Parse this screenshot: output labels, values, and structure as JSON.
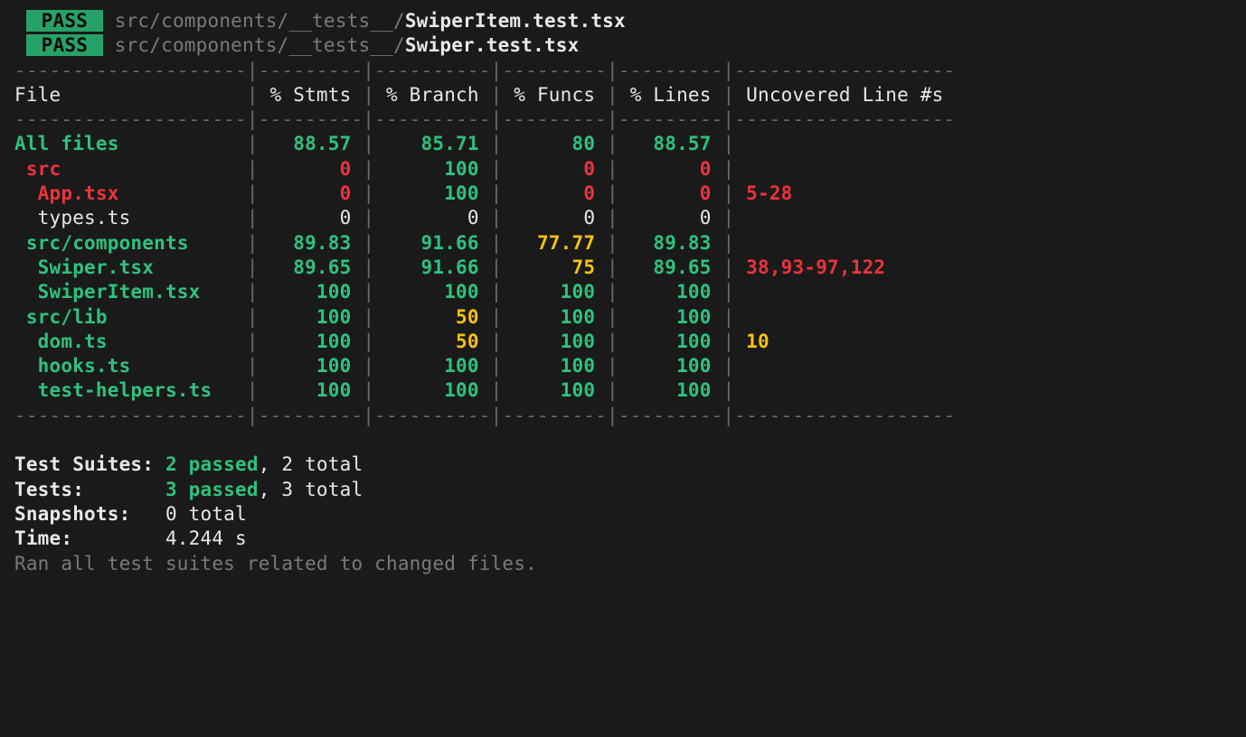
{
  "test_files": [
    {
      "status": "PASS",
      "path_prefix": "src/components/__tests__/",
      "filename": "SwiperItem.test.tsx"
    },
    {
      "status": "PASS",
      "path_prefix": "src/components/__tests__/",
      "filename": "Swiper.test.tsx"
    }
  ],
  "coverage_header": {
    "file": "File",
    "stmts": "% Stmts",
    "branch": "% Branch",
    "funcs": "% Funcs",
    "lines": "% Lines",
    "uncovered": "Uncovered Line #s"
  },
  "coverage_rows": [
    {
      "indent": 0,
      "name": "All files",
      "name_color": "green-bold",
      "stmts": {
        "v": "88.57",
        "c": "green"
      },
      "branch": {
        "v": "85.71",
        "c": "green"
      },
      "funcs": {
        "v": "80",
        "c": "green"
      },
      "lines": {
        "v": "88.57",
        "c": "green"
      },
      "uncovered": {
        "v": "",
        "c": ""
      }
    },
    {
      "indent": 1,
      "name": "src",
      "name_color": "red",
      "stmts": {
        "v": "0",
        "c": "red"
      },
      "branch": {
        "v": "100",
        "c": "green"
      },
      "funcs": {
        "v": "0",
        "c": "red"
      },
      "lines": {
        "v": "0",
        "c": "red"
      },
      "uncovered": {
        "v": "",
        "c": ""
      }
    },
    {
      "indent": 2,
      "name": "App.tsx",
      "name_color": "red",
      "stmts": {
        "v": "0",
        "c": "red"
      },
      "branch": {
        "v": "100",
        "c": "green"
      },
      "funcs": {
        "v": "0",
        "c": "red"
      },
      "lines": {
        "v": "0",
        "c": "red"
      },
      "uncovered": {
        "v": "5-28",
        "c": "red"
      }
    },
    {
      "indent": 2,
      "name": "types.ts",
      "name_color": "white",
      "stmts": {
        "v": "0",
        "c": "white"
      },
      "branch": {
        "v": "0",
        "c": "white"
      },
      "funcs": {
        "v": "0",
        "c": "white"
      },
      "lines": {
        "v": "0",
        "c": "white"
      },
      "uncovered": {
        "v": "",
        "c": ""
      }
    },
    {
      "indent": 1,
      "name": "src/components",
      "name_color": "green-bold",
      "stmts": {
        "v": "89.83",
        "c": "green"
      },
      "branch": {
        "v": "91.66",
        "c": "green"
      },
      "funcs": {
        "v": "77.77",
        "c": "yellow"
      },
      "lines": {
        "v": "89.83",
        "c": "green"
      },
      "uncovered": {
        "v": "",
        "c": ""
      }
    },
    {
      "indent": 2,
      "name": "Swiper.tsx",
      "name_color": "green-bold",
      "stmts": {
        "v": "89.65",
        "c": "green"
      },
      "branch": {
        "v": "91.66",
        "c": "green"
      },
      "funcs": {
        "v": "75",
        "c": "yellow"
      },
      "lines": {
        "v": "89.65",
        "c": "green"
      },
      "uncovered": {
        "v": "38,93-97,122",
        "c": "red"
      }
    },
    {
      "indent": 2,
      "name": "SwiperItem.tsx",
      "name_color": "green-bold",
      "stmts": {
        "v": "100",
        "c": "green"
      },
      "branch": {
        "v": "100",
        "c": "green"
      },
      "funcs": {
        "v": "100",
        "c": "green"
      },
      "lines": {
        "v": "100",
        "c": "green"
      },
      "uncovered": {
        "v": "",
        "c": ""
      }
    },
    {
      "indent": 1,
      "name": "src/lib",
      "name_color": "green-bold",
      "stmts": {
        "v": "100",
        "c": "green"
      },
      "branch": {
        "v": "50",
        "c": "yellow"
      },
      "funcs": {
        "v": "100",
        "c": "green"
      },
      "lines": {
        "v": "100",
        "c": "green"
      },
      "uncovered": {
        "v": "",
        "c": ""
      }
    },
    {
      "indent": 2,
      "name": "dom.ts",
      "name_color": "green-bold",
      "stmts": {
        "v": "100",
        "c": "green"
      },
      "branch": {
        "v": "50",
        "c": "yellow"
      },
      "funcs": {
        "v": "100",
        "c": "green"
      },
      "lines": {
        "v": "100",
        "c": "green"
      },
      "uncovered": {
        "v": "10",
        "c": "yellow"
      }
    },
    {
      "indent": 2,
      "name": "hooks.ts",
      "name_color": "green-bold",
      "stmts": {
        "v": "100",
        "c": "green"
      },
      "branch": {
        "v": "100",
        "c": "green"
      },
      "funcs": {
        "v": "100",
        "c": "green"
      },
      "lines": {
        "v": "100",
        "c": "green"
      },
      "uncovered": {
        "v": "",
        "c": ""
      }
    },
    {
      "indent": 2,
      "name": "test-helpers.ts",
      "name_color": "green-bold",
      "stmts": {
        "v": "100",
        "c": "green"
      },
      "branch": {
        "v": "100",
        "c": "green"
      },
      "funcs": {
        "v": "100",
        "c": "green"
      },
      "lines": {
        "v": "100",
        "c": "green"
      },
      "uncovered": {
        "v": "",
        "c": ""
      }
    }
  ],
  "summary": {
    "suites_label": "Test Suites:",
    "suites_passed": "2 passed",
    "suites_total": ", 2 total",
    "tests_label": "Tests:",
    "tests_passed": "3 passed",
    "tests_total": ", 3 total",
    "snapshots_label": "Snapshots:",
    "snapshots_value": "0 total",
    "time_label": "Time:",
    "time_value": "4.244 s",
    "footer": "Ran all test suites related to changed files."
  },
  "layout": {
    "col_widths": {
      "file": 20,
      "stmts": 9,
      "branch": 10,
      "funcs": 9,
      "lines": 9,
      "uncovered": 19
    }
  }
}
